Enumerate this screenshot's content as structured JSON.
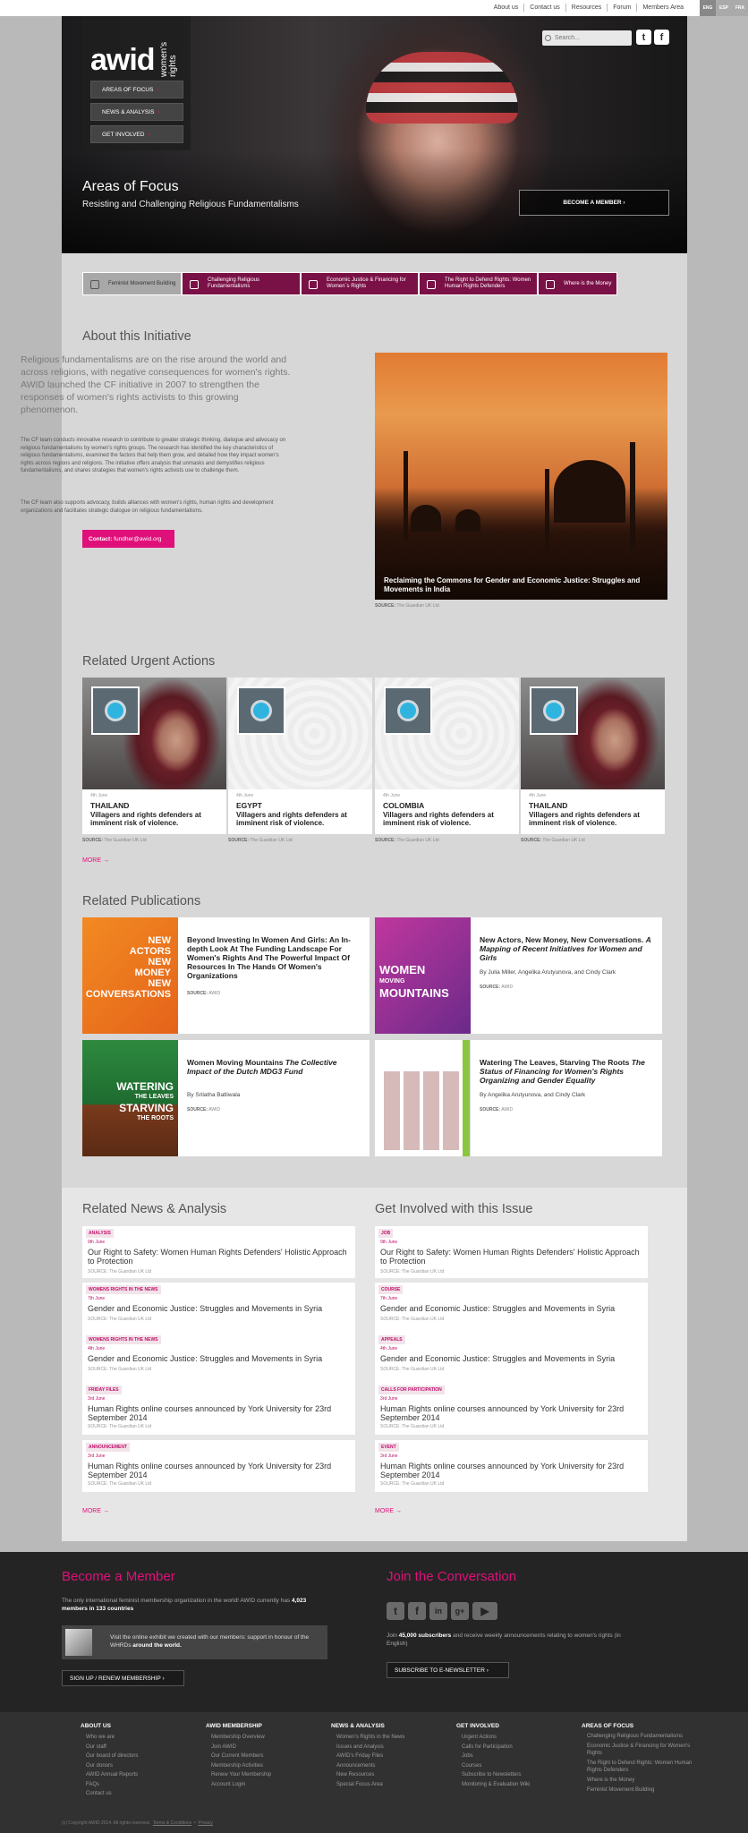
{
  "topnav": {
    "links": [
      "About us",
      "Contact us",
      "Resources",
      "Forum",
      "Members Area"
    ],
    "langs": [
      "ENG",
      "ESP",
      "FRA"
    ]
  },
  "hero": {
    "logo_text": "awid",
    "logo_sub": "women's rights",
    "nav": [
      "AREAS OF FOCUS",
      "NEWS & ANALYSIS",
      "GET INVOLVED"
    ],
    "search_placeholder": "Search...",
    "title": "Areas of Focus",
    "subtitle": "Resisting and Challenging Religious Fundamentalisms",
    "member_button": "BECOME A MEMBER"
  },
  "focus_tabs": [
    "Feminist Movement Building",
    "Challenging Religious Fundamentalisms",
    "Economic Justice & Financing for Women´s Rights",
    "The Right to Defend Rights: Women Human Rights Defenders",
    "Where is the Money"
  ],
  "about": {
    "title": "About this Initiative",
    "lead": "Religious fundamentalisms are on the rise around the world and across religions, with negative consequences for women's rights. AWID launched the CF initiative in 2007 to strengthen the responses of women's rights activists to this growing phenomenon.",
    "p1": "The CF team conducts innovative research to contribute to greater strategic thinking, dialogue and advocacy on religious fundamentalisms by women's rights groups. The research has identified the key characteristics of religious fundamentalisms, examined the factors that help them grow, and detailed how they impact women's rights across regions and religions. The initiative offers analysis that unmasks and demystifies religious fundamentalisms, and shares strategies that women's rights activists use to challenge them.",
    "p2": "The CF team also supports advocacy, builds alliances with women's rights, human rights and development organizations and facilitates strategic dialogue on religious fundamentalisms.",
    "contact_label": "Contact:",
    "contact_email": "fundher@awid.org",
    "feature_caption": "Reclaiming the Commons for Gender and Economic Justice: Struggles and Movements in India",
    "source_label": "SOURCE:",
    "source_value": "The Guardian UK Ltd"
  },
  "urgent": {
    "title": "Related Urgent Actions",
    "cards": [
      {
        "date": "4th June",
        "country": "THAILAND",
        "text": "Villagers and rights defenders at imminent risk of violence.",
        "image": "woman"
      },
      {
        "date": "4th June",
        "country": "EGYPT",
        "text": "Villagers and rights defenders at imminent risk of violence.",
        "image": "map"
      },
      {
        "date": "4th June",
        "country": "COLOMBIA",
        "text": "Villagers and rights defenders at imminent risk of violence.",
        "image": "map"
      },
      {
        "date": "4th June",
        "country": "THAILAND",
        "text": "Villagers and rights defenders at imminent risk of violence.",
        "image": "woman"
      }
    ],
    "source_label": "SOURCE:",
    "source_value": "The Guardian UK Ltd",
    "more": "MORE"
  },
  "publications": {
    "title": "Related Publications",
    "items": [
      {
        "title": "Beyond Investing In Women And Girls: An In-depth Look At The Funding Landscape For Women's Rights And The Powerful Impact Of Resources In The Hands Of Women's Organizations",
        "subtitle": "",
        "authors": "",
        "source_label": "SOURCE:",
        "source": "AWID",
        "cover_words": [
          "NEW",
          "ACTORS",
          "NEW",
          "MONEY",
          "NEW",
          "CONVERSATIONS"
        ],
        "cover_color": "#f07c1e"
      },
      {
        "title": "New Actors, New Money, New Conversations.",
        "subtitle": "A Mapping of Recent Initiatives for Women and Girls",
        "authors": "By Julia Miller, Angelika Arutyunova, and Cindy Clark",
        "source_label": "SOURCE:",
        "source": "AWID",
        "cover_words": [
          "WOMEN",
          "MOVING",
          "MOUNTAINS"
        ],
        "cover_color": "#a52f8c"
      },
      {
        "title": "Women Moving Mountains",
        "subtitle": "The Collective Impact of the Dutch MDG3 Fund",
        "authors": "By Srilatha Batliwala",
        "source_label": "SOURCE:",
        "source": "AWID",
        "cover_words": [
          "WATERING",
          "THE LEAVES",
          "STARVING",
          "THE ROOTS"
        ],
        "cover_color": "#2e8a3e"
      },
      {
        "title": "Watering The Leaves, Starving The Roots",
        "subtitle": "The Status of Financing for Women's Rights Organizing and Gender Equality",
        "authors": "By Angelika Arutyunova, and Cindy Clark",
        "source_label": "SOURCE:",
        "source": "AWID",
        "cover_words": [],
        "cover_color": "#ffffff"
      }
    ]
  },
  "news": {
    "title": "Related News & Analysis",
    "items": [
      {
        "tag": "ANALYSIS",
        "date": "9th June",
        "title": "Our Right to Safety: Women Human Rights Defenders' Holistic Approach to Protection",
        "source": "SOURCE: The Guardian UK Ltd"
      },
      {
        "tag": "WOMENS RIGHTS IN THE NEWS",
        "date": "7th June",
        "title": "Gender and Economic Justice: Struggles and Movements in Syria",
        "source": "SOURCE: The Guardian UK Ltd"
      },
      {
        "tag": "WOMENS RIGHTS IN THE NEWS",
        "date": "4th June",
        "title": "Gender and Economic Justice: Struggles and Movements in Syria",
        "source": "SOURCE: The Guardian UK Ltd"
      },
      {
        "tag": "FRIDAY FILES",
        "date": "3rd June",
        "title": "Human Rights online courses announced by York University for 23rd September 2014",
        "source": "SOURCE: The Guardian UK Ltd"
      },
      {
        "tag": "ANNOUNCEMENT",
        "date": "3rd June",
        "title": "Human Rights online courses announced by York University for 23rd September 2014",
        "source": "SOURCE: The Guardian UK Ltd"
      }
    ],
    "more": "MORE"
  },
  "involved": {
    "title": "Get Involved with this Issue",
    "items": [
      {
        "tag": "JOB",
        "date": "9th June",
        "title": "Our Right to Safety: Women Human Rights Defenders' Holistic Approach to Protection",
        "source": "SOURCE: The Guardian UK Ltd"
      },
      {
        "tag": "COURSE",
        "date": "7th June",
        "title": "Gender and Economic Justice: Struggles and Movements in Syria",
        "source": "SOURCE: The Guardian UK Ltd"
      },
      {
        "tag": "APPEALS",
        "date": "4th June",
        "title": "Gender and Economic Justice: Struggles and Movements in Syria",
        "source": "SOURCE: The Guardian UK Ltd"
      },
      {
        "tag": "CALLS FOR PARTICIPATION",
        "date": "3rd June",
        "title": "Human Rights online courses announced by York University for 23rd September 2014",
        "source": "SOURCE: The Guardian UK Ltd"
      },
      {
        "tag": "EVENT",
        "date": "3rd June",
        "title": "Human Rights online courses announced by York University for 23rd September 2014",
        "source": "SOURCE: The Guardian UK Ltd"
      }
    ],
    "more": "MORE"
  },
  "member": {
    "title": "Become a Member",
    "text": "The only international feminist membership organization in the world! AWID currently has",
    "count": "4,023 members in 133 countries",
    "exhibit_text": "Visit the online exhibit we created with our members: support in honour of the WHRDs",
    "exhibit_bold": "around the world.",
    "button": "SIGN UP / RENEW MEMBERSHIP"
  },
  "conversation": {
    "title": "Join the Conversation",
    "join": "Join",
    "subs": "45,000 subscribers",
    "text": "and receive weekly announcements relating to women's rights (in English)",
    "button": "SUBSCRIBE TO E-NEWSLETTER"
  },
  "footer": {
    "columns": [
      {
        "heading": "ABOUT US",
        "links": [
          "Who we are",
          "Our staff",
          "Our board of directors",
          "Our donors",
          "AWID Annual Reports",
          "FAQs",
          "Contact us"
        ]
      },
      {
        "heading": "AWID MEMBERSHIP",
        "links": [
          "Membership Overview",
          "Join AWID",
          "Our Current Members",
          "Membership Activities",
          "Renew Your Membership",
          "Account Login"
        ]
      },
      {
        "heading": "NEWS & ANALYSIS",
        "links": [
          "Women's Rights in the News",
          "Issues and Analysis",
          "AWID's Friday Files",
          "Announcements",
          "New Resources",
          "Special Focus Area"
        ]
      },
      {
        "heading": "GET INVOLVED",
        "links": [
          "Urgent Actions",
          "Calls for Participation",
          "Jobs",
          "Courses",
          "Subscribe to Newsletters",
          "Monitoring & Evaluation Wiki"
        ]
      },
      {
        "heading": "AREAS OF FOCUS",
        "links": [
          "Challenging Religious Fundamentalisms",
          "Economic Justice & Financing for Women's Rights",
          "The Right to Defend Rights: Women Human Rights Defenders",
          "Where is the Money",
          "Feminist Movement Building"
        ]
      }
    ],
    "copyright": "(c) Copyright AWID 2014. All rights reserved.",
    "terms": "Terms & Conditions",
    "privacy": "Privacy"
  },
  "colors": {
    "accent": "#e0107a",
    "tab": "#7a1146",
    "dark": "#242424"
  }
}
